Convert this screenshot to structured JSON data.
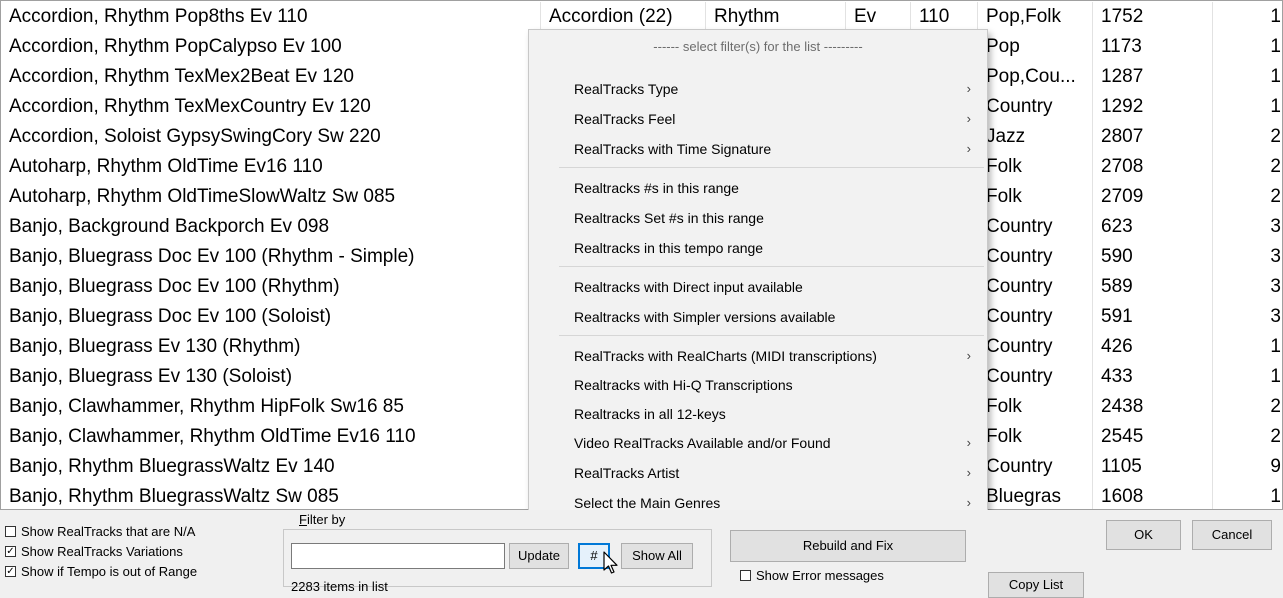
{
  "list_rows": [
    {
      "name": "Accordion, Rhythm Pop8ths Ev 110",
      "inst": "Accordion (22)",
      "kind": "Rhythm",
      "feel": "Ev",
      "tempo": "110",
      "genre": "Pop,Folk",
      "num": "1752",
      "last": "1"
    },
    {
      "name": "Accordion, Rhythm PopCalypso Ev 100",
      "inst": "",
      "kind": "",
      "feel": "",
      "tempo": "",
      "genre": "Pop",
      "num": "1173",
      "last": "1"
    },
    {
      "name": "Accordion, Rhythm TexMex2Beat Ev 120",
      "inst": "",
      "kind": "",
      "feel": "",
      "tempo": "",
      "genre": "Pop,Cou...",
      "num": "1287",
      "last": "1"
    },
    {
      "name": "Accordion, Rhythm TexMexCountry Ev 120",
      "inst": "",
      "kind": "",
      "feel": "",
      "tempo": "",
      "genre": "Country",
      "num": "1292",
      "last": "1"
    },
    {
      "name": "Accordion, Soloist GypsySwingCory Sw 220",
      "inst": "",
      "kind": "",
      "feel": "",
      "tempo": "",
      "genre": "Jazz",
      "num": "2807",
      "last": "2"
    },
    {
      "name": "Autoharp, Rhythm OldTime Ev16 110",
      "inst": "",
      "kind": "",
      "feel": "",
      "tempo": "",
      "genre": "Folk",
      "num": "2708",
      "last": "2"
    },
    {
      "name": "Autoharp, Rhythm OldTimeSlowWaltz Sw 085",
      "inst": "",
      "kind": "",
      "feel": "",
      "tempo": "",
      "genre": "Folk",
      "num": "2709",
      "last": "2"
    },
    {
      "name": "Banjo, Background Backporch Ev 098",
      "inst": "",
      "kind": "",
      "feel": "",
      "tempo": "",
      "genre": "Country",
      "num": "623",
      "last": "3"
    },
    {
      "name": "Banjo, Bluegrass Doc Ev 100 (Rhythm - Simple)",
      "inst": "",
      "kind": "",
      "feel": "",
      "tempo": "",
      "genre": "Country",
      "num": "590",
      "last": "3"
    },
    {
      "name": "Banjo, Bluegrass Doc Ev 100 (Rhythm)",
      "inst": "",
      "kind": "",
      "feel": "",
      "tempo": "",
      "genre": "Country",
      "num": "589",
      "last": "3"
    },
    {
      "name": "Banjo, Bluegrass Doc Ev 100 (Soloist)",
      "inst": "",
      "kind": "",
      "feel": "",
      "tempo": "",
      "genre": "Country",
      "num": "591",
      "last": "3"
    },
    {
      "name": "Banjo, Bluegrass Ev 130 (Rhythm)",
      "inst": "",
      "kind": "",
      "feel": "",
      "tempo": "",
      "genre": "Country",
      "num": "426",
      "last": "1"
    },
    {
      "name": "Banjo, Bluegrass Ev 130 (Soloist)",
      "inst": "",
      "kind": "",
      "feel": "",
      "tempo": "",
      "genre": "Country",
      "num": "433",
      "last": "1"
    },
    {
      "name": "Banjo, Clawhammer, Rhythm HipFolk Sw16 85",
      "inst": "",
      "kind": "",
      "feel": "",
      "tempo": "",
      "genre": "Folk",
      "num": "2438",
      "last": "2"
    },
    {
      "name": "Banjo, Clawhammer, Rhythm OldTime Ev16 110",
      "inst": "",
      "kind": "",
      "feel": "",
      "tempo": "",
      "genre": "Folk",
      "num": "2545",
      "last": "2"
    },
    {
      "name": "Banjo, Rhythm BluegrassWaltz Ev 140",
      "inst": "",
      "kind": "",
      "feel": "",
      "tempo": "",
      "genre": "Country",
      "num": "1105",
      "last": "9"
    },
    {
      "name": "Banjo, Rhythm BluegrassWaltz Sw 085",
      "inst": "",
      "kind": "",
      "feel": "",
      "tempo": "",
      "genre": "Bluegras",
      "num": "1608",
      "last": "1"
    }
  ],
  "menu": {
    "header": "------ select filter(s) for the list ---------",
    "items": [
      {
        "label": "RealTracks Type",
        "submenu": true
      },
      {
        "label": "RealTracks Feel",
        "submenu": true
      },
      {
        "label": "RealTracks with Time Signature",
        "submenu": true
      },
      {
        "label": "Realtracks #s in this range",
        "submenu": false
      },
      {
        "label": "Realtracks Set #s in this range",
        "submenu": false
      },
      {
        "label": "Realtracks in this tempo range",
        "submenu": false
      },
      {
        "label": "Realtracks with Direct input available",
        "submenu": false
      },
      {
        "label": "Realtracks with Simpler versions available",
        "submenu": false
      },
      {
        "label": "RealTracks with RealCharts (MIDI  transcriptions)",
        "submenu": true
      },
      {
        "label": "Realtracks with Hi-Q Transcriptions",
        "submenu": false
      },
      {
        "label": "Realtracks in all 12-keys",
        "submenu": false
      },
      {
        "label": "Video RealTracks Available and/or Found",
        "submenu": true
      },
      {
        "label": "RealTracks Artist",
        "submenu": true
      },
      {
        "label": "Select the Main Genres",
        "submenu": true
      }
    ],
    "arrow_glyph": "›"
  },
  "bottom": {
    "chk_na": "Show RealTracks that are N/A",
    "chk_variations": "Show RealTracks Variations",
    "chk_tempo": "Show if Tempo is out of Range",
    "filter_title_first": "F",
    "filter_title_rest": "ilter by",
    "filter_value": "",
    "update_label": "Update",
    "hash_label": "#",
    "show_all_label": "Show All",
    "items_count": "2283 items in list",
    "rebuild_label": "Rebuild and Fix",
    "chk_errors": "Show Error messages",
    "copy_list_label": "Copy List",
    "ok_label": "OK",
    "cancel_label": "Cancel",
    "check_glyph": "✓"
  },
  "colors": {
    "accent_focus": "#0078d7",
    "menu_bg": "#f2f2f2",
    "window_bg": "#f0f0f0"
  }
}
